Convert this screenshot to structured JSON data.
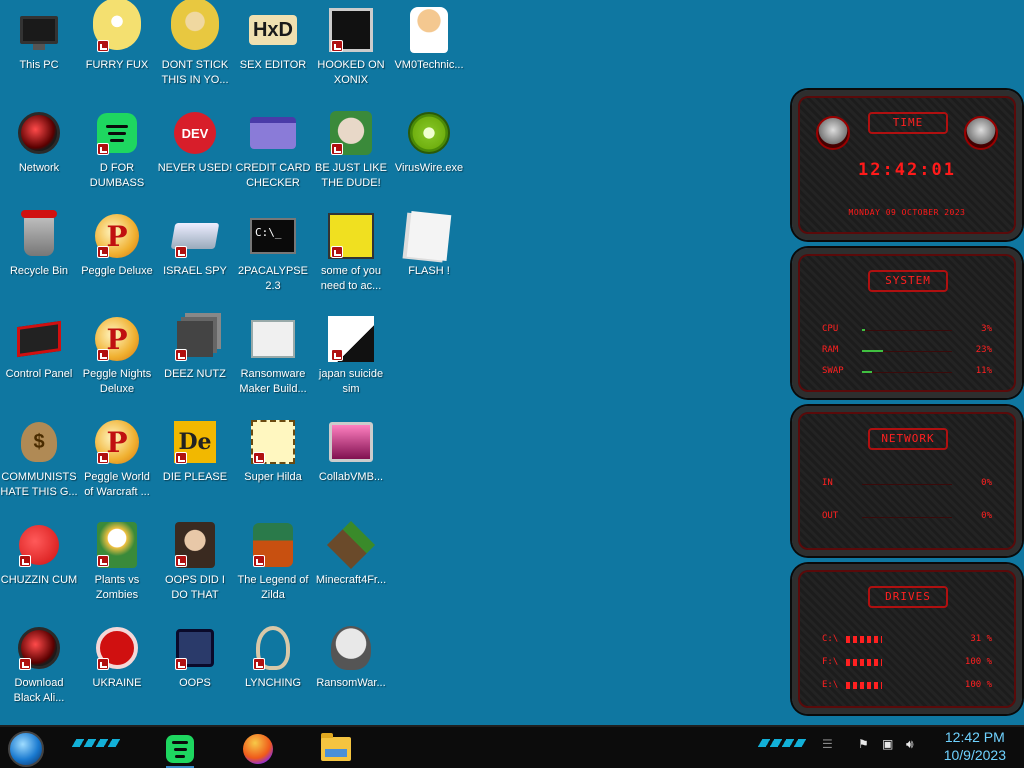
{
  "desktop": {
    "icons": [
      {
        "label": "This PC",
        "icon": "computer-icon"
      },
      {
        "label": "FURRY FUX",
        "icon": "cartoon-icon"
      },
      {
        "label": "DONT STICK THIS IN YO...",
        "icon": "cartoon-icon"
      },
      {
        "label": "SEX EDITOR",
        "icon": "hxd-icon"
      },
      {
        "label": "HOOKED ON XONIX",
        "icon": "maze-icon"
      },
      {
        "label": "VM0Technic...",
        "icon": "doctor-icon"
      },
      {
        "label": "Network",
        "icon": "network-orb-icon"
      },
      {
        "label": "D FOR DUMBASS",
        "icon": "spotify-icon"
      },
      {
        "label": "NEVER USED!",
        "icon": "dev-icon"
      },
      {
        "label": "CREDIT CARD CHECKER",
        "icon": "credit-card-icon"
      },
      {
        "label": "BE JUST LIKE THE DUDE!",
        "icon": "elf-icon"
      },
      {
        "label": "VirusWire.exe",
        "icon": "lime-icon"
      },
      {
        "label": "Recycle Bin",
        "icon": "recycle-bin-icon"
      },
      {
        "label": "Peggle Deluxe",
        "icon": "peggle-icon"
      },
      {
        "label": "ISRAEL SPY",
        "icon": "scanner-icon"
      },
      {
        "label": "2PACALYPSE 2.3",
        "icon": "terminal-icon"
      },
      {
        "label": "some of you need to ac...",
        "icon": "dog-icon"
      },
      {
        "label": "FLASH !",
        "icon": "flash-icon"
      },
      {
        "label": "Control Panel",
        "icon": "control-panel-icon"
      },
      {
        "label": "Peggle Nights Deluxe",
        "icon": "peggle-icon"
      },
      {
        "label": "DEEZ NUTZ",
        "icon": "stack-icon"
      },
      {
        "label": "Ransomware Maker Build...",
        "icon": "window-icon"
      },
      {
        "label": "japan suicide sim",
        "icon": "japan-icon"
      },
      {
        "label": "COMMUNISTS HATE THIS G...",
        "icon": "money-bag-icon"
      },
      {
        "label": "Peggle World of Warcraft ...",
        "icon": "peggle-icon"
      },
      {
        "label": "DIE PLEASE",
        "icon": "de-icon"
      },
      {
        "label": "Super Hilda",
        "icon": "hilda-icon"
      },
      {
        "label": "CollabVMB...",
        "icon": "collab-icon"
      },
      {
        "label": "CHUZZIN CUM",
        "icon": "chuzzle-icon"
      },
      {
        "label": "Plants vs Zombies",
        "icon": "flower-icon"
      },
      {
        "label": "OOPS DID I DO THAT",
        "icon": "portrait-icon"
      },
      {
        "label": "The Legend of Zilda",
        "icon": "soldier-icon"
      },
      {
        "label": "Minecraft4Fr...",
        "icon": "grass-block-icon"
      },
      {
        "label": "Download Black Ali...",
        "icon": "alienware-orb-icon"
      },
      {
        "label": "UKRAINE",
        "icon": "radiation-icon"
      },
      {
        "label": "OOPS",
        "icon": "mac-icon"
      },
      {
        "label": "LYNCHING",
        "icon": "noose-icon"
      },
      {
        "label": "RansomWar...",
        "icon": "skull-icon"
      }
    ]
  },
  "widget": {
    "time": {
      "title": "TIME",
      "clock": "12:42:01",
      "date": "MONDAY 09 OCTOBER 2023"
    },
    "system": {
      "title": "SYSTEM",
      "rows": [
        {
          "label": "CPU",
          "value": "3%",
          "level": 0.03
        },
        {
          "label": "RAM",
          "value": "23%",
          "level": 0.23
        },
        {
          "label": "SWAP",
          "value": "11%",
          "level": 0.11
        }
      ]
    },
    "network": {
      "title": "NETWORK",
      "rows": [
        {
          "label": "IN",
          "value": "0%"
        },
        {
          "label": "OUT",
          "value": "0%"
        }
      ]
    },
    "drives": {
      "title": "DRIVES",
      "rows": [
        {
          "label": "C:\\",
          "value": "31 %"
        },
        {
          "label": "F:\\",
          "value": "100 %"
        },
        {
          "label": "E:\\",
          "value": "100 %"
        }
      ]
    },
    "accent": "#ff2020"
  },
  "taskbar": {
    "apps": [
      {
        "name": "Spotify",
        "icon": "spotify-icon",
        "active": true
      },
      {
        "name": "Firefox",
        "icon": "firefox-icon",
        "active": false
      },
      {
        "name": "File Explorer",
        "icon": "folder-icon",
        "active": false
      }
    ],
    "tray_icons": [
      "flag-icon",
      "network-icon",
      "volume-icon"
    ],
    "time": "12:42 PM",
    "date": "10/9/2023",
    "clock_color": "#6fd2ff"
  },
  "colors": {
    "desktop_bg": "#0f77a1",
    "taskbar_bg": "#0c0c0c"
  }
}
